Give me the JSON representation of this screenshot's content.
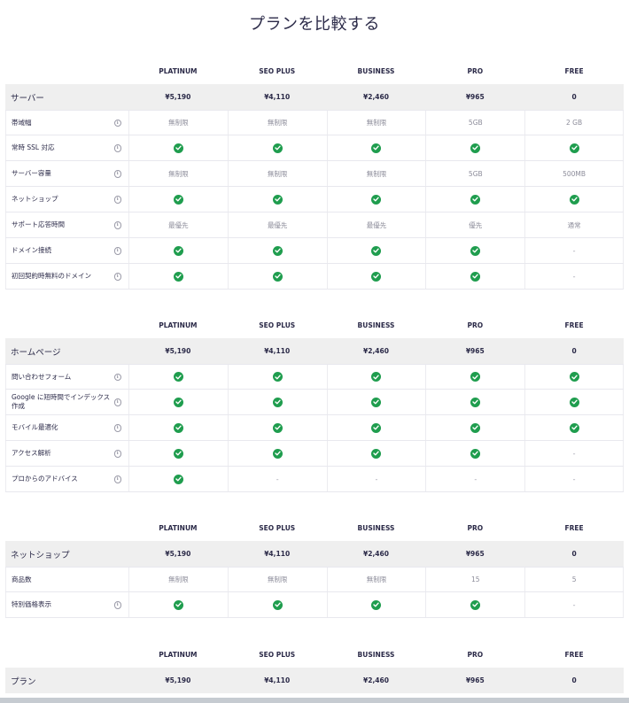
{
  "page": {
    "title": "プランを比較する"
  },
  "plans": [
    "PLATINUM",
    "SEO PLUS",
    "BUSINESS",
    "PRO",
    "FREE"
  ],
  "prices": [
    "¥5,190",
    "¥4,110",
    "¥2,460",
    "¥965",
    "0"
  ],
  "sections": [
    {
      "title": "サーバー",
      "rows": [
        {
          "label": "帯域幅",
          "info": true,
          "cells": [
            {
              "t": "text",
              "v": "無制限"
            },
            {
              "t": "text",
              "v": "無制限"
            },
            {
              "t": "text",
              "v": "無制限"
            },
            {
              "t": "text",
              "v": "5GB"
            },
            {
              "t": "text",
              "v": "2 GB"
            }
          ]
        },
        {
          "label": "常時 SSL 対応",
          "info": true,
          "cells": [
            {
              "t": "check"
            },
            {
              "t": "check"
            },
            {
              "t": "check"
            },
            {
              "t": "check"
            },
            {
              "t": "check"
            }
          ]
        },
        {
          "label": "サーバー容量",
          "info": true,
          "cells": [
            {
              "t": "text",
              "v": "無制限"
            },
            {
              "t": "text",
              "v": "無制限"
            },
            {
              "t": "text",
              "v": "無制限"
            },
            {
              "t": "text",
              "v": "5GB"
            },
            {
              "t": "text",
              "v": "500MB"
            }
          ]
        },
        {
          "label": "ネットショップ",
          "info": true,
          "cells": [
            {
              "t": "check"
            },
            {
              "t": "check"
            },
            {
              "t": "check"
            },
            {
              "t": "check"
            },
            {
              "t": "check"
            }
          ]
        },
        {
          "label": "サポート応答時間",
          "info": true,
          "cells": [
            {
              "t": "text",
              "v": "最優先"
            },
            {
              "t": "text",
              "v": "最優先"
            },
            {
              "t": "text",
              "v": "最優先"
            },
            {
              "t": "text",
              "v": "優先"
            },
            {
              "t": "text",
              "v": "通常"
            }
          ]
        },
        {
          "label": "ドメイン接続",
          "info": true,
          "cells": [
            {
              "t": "check"
            },
            {
              "t": "check"
            },
            {
              "t": "check"
            },
            {
              "t": "check"
            },
            {
              "t": "dash",
              "v": "-"
            }
          ]
        },
        {
          "label": "初回契約時無料のドメイン",
          "info": true,
          "cells": [
            {
              "t": "check"
            },
            {
              "t": "check"
            },
            {
              "t": "check"
            },
            {
              "t": "check"
            },
            {
              "t": "dash",
              "v": "-"
            }
          ]
        }
      ]
    },
    {
      "title": "ホームページ",
      "rows": [
        {
          "label": "問い合わせフォーム",
          "info": true,
          "cells": [
            {
              "t": "check"
            },
            {
              "t": "check"
            },
            {
              "t": "check"
            },
            {
              "t": "check"
            },
            {
              "t": "check"
            }
          ]
        },
        {
          "label": "Google に短時間でインデックス作成",
          "info": true,
          "cells": [
            {
              "t": "check"
            },
            {
              "t": "check"
            },
            {
              "t": "check"
            },
            {
              "t": "check"
            },
            {
              "t": "check"
            }
          ]
        },
        {
          "label": "モバイル最適化",
          "info": true,
          "cells": [
            {
              "t": "check"
            },
            {
              "t": "check"
            },
            {
              "t": "check"
            },
            {
              "t": "check"
            },
            {
              "t": "check"
            }
          ]
        },
        {
          "label": "アクセス解析",
          "info": true,
          "cells": [
            {
              "t": "check"
            },
            {
              "t": "check"
            },
            {
              "t": "check"
            },
            {
              "t": "check"
            },
            {
              "t": "dash",
              "v": "-"
            }
          ]
        },
        {
          "label": "プロからのアドバイス",
          "info": true,
          "cells": [
            {
              "t": "check"
            },
            {
              "t": "dash",
              "v": "-"
            },
            {
              "t": "dash",
              "v": "-"
            },
            {
              "t": "dash",
              "v": "-"
            },
            {
              "t": "dash",
              "v": "-"
            }
          ]
        }
      ]
    },
    {
      "title": "ネットショップ",
      "rows": [
        {
          "label": "商品数",
          "info": false,
          "cells": [
            {
              "t": "text",
              "v": "無制限"
            },
            {
              "t": "text",
              "v": "無制限"
            },
            {
              "t": "text",
              "v": "無制限"
            },
            {
              "t": "text",
              "v": "15"
            },
            {
              "t": "text",
              "v": "5"
            }
          ]
        },
        {
          "label": "特別価格表示",
          "info": true,
          "cells": [
            {
              "t": "check"
            },
            {
              "t": "check"
            },
            {
              "t": "check"
            },
            {
              "t": "check"
            },
            {
              "t": "dash",
              "v": "-"
            }
          ]
        }
      ]
    },
    {
      "title": "プラン",
      "rows": []
    }
  ],
  "icons": {
    "info": "info-icon",
    "check": "check-icon",
    "info_glyph": "i"
  },
  "colors": {
    "check": "#1f9d4e",
    "price_row_bg": "#efefef",
    "title": "#2b2a48"
  }
}
